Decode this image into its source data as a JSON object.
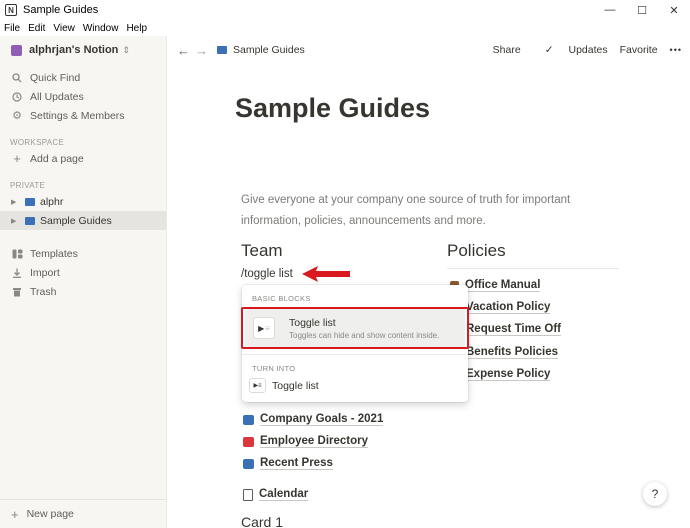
{
  "window": {
    "title": "Sample Guides",
    "app_icon": "N"
  },
  "menu": [
    "File",
    "Edit",
    "View",
    "Window",
    "Help"
  ],
  "sidebar": {
    "workspace": "alphrjan's Notion",
    "top_items": [
      {
        "label": "Quick Find",
        "icon": "search-icon"
      },
      {
        "label": "All Updates",
        "icon": "clock-icon"
      },
      {
        "label": "Settings & Members",
        "icon": "gear-icon"
      }
    ],
    "workspace_label": "WORKSPACE",
    "add_page": "Add a page",
    "private_label": "PRIVATE",
    "pages": [
      {
        "label": "alphr",
        "active": false
      },
      {
        "label": "Sample Guides",
        "active": true
      }
    ],
    "bottom_items": [
      {
        "label": "Templates",
        "icon": "templates-icon"
      },
      {
        "label": "Import",
        "icon": "import-icon"
      },
      {
        "label": "Trash",
        "icon": "trash-icon"
      }
    ],
    "new_page": "New page"
  },
  "topbar": {
    "breadcrumb": "Sample Guides",
    "share": "Share",
    "updates": "Updates",
    "favorite": "Favorite",
    "more": "•••"
  },
  "page": {
    "title": "Sample Guides",
    "description": "Give everyone at your company one source of truth for important information, policies, announcements and more.",
    "team_heading": "Team",
    "policies_heading": "Policies",
    "command_text": "/toggle list",
    "team_links": [
      {
        "label": "Company Goals - 2021",
        "color": "#3b6fb6"
      },
      {
        "label": "Employee Directory",
        "color": "#d9363e"
      },
      {
        "label": "Recent Press",
        "color": "#3b6fb6"
      },
      {
        "label": "Calendar",
        "color": "#5f5e5b"
      }
    ],
    "policy_links": [
      "Office Manual",
      "Vacation Policy",
      "Request Time Off",
      "Benefits Policies",
      "Expense Policy"
    ],
    "card": "Card 1"
  },
  "popup": {
    "section1": "BASIC BLOCKS",
    "option_title": "Toggle list",
    "option_subtitle": "Toggles can hide and show content inside.",
    "section2": "TURN INTO",
    "turn_into_label": "Toggle list"
  },
  "help": "?",
  "colors": {
    "annotation_red": "#d9181f",
    "sidebar_bg": "#f7f6f3"
  }
}
